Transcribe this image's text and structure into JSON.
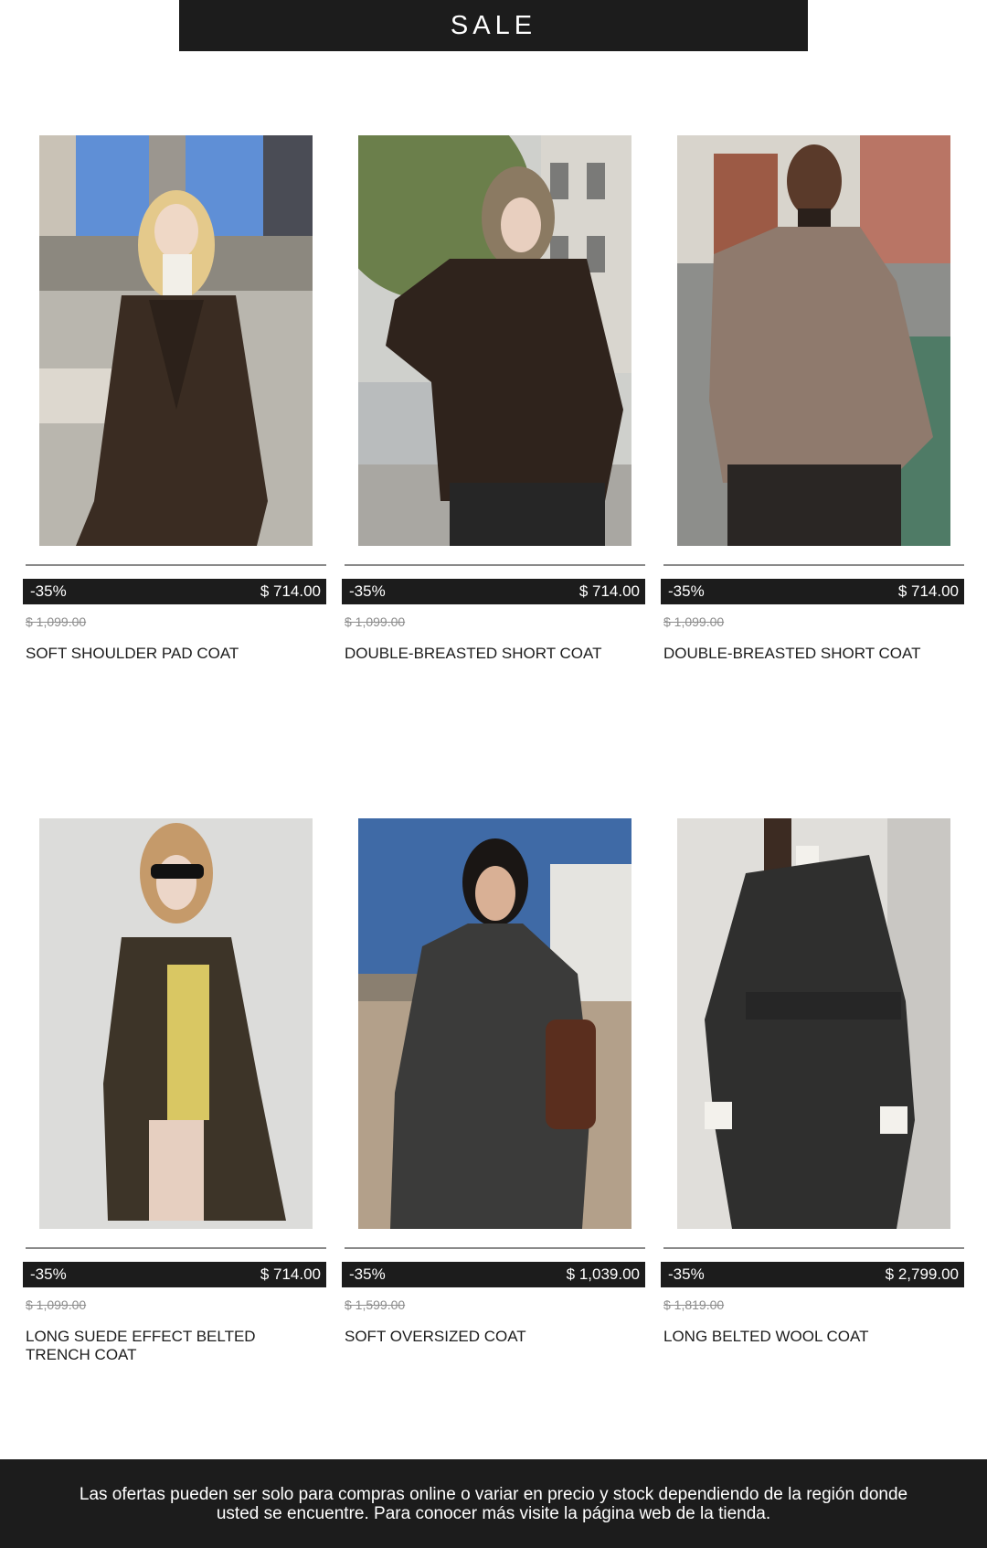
{
  "banner": {
    "title": "SALE"
  },
  "products": [
    {
      "discount": "-35%",
      "price": "$ 714.00",
      "old_price": "$ 1,099.00",
      "name": "SOFT SHOULDER PAD COAT"
    },
    {
      "discount": "-35%",
      "price": "$ 714.00",
      "old_price": "$ 1,099.00",
      "name": "DOUBLE-BREASTED SHORT COAT"
    },
    {
      "discount": "-35%",
      "price": "$ 714.00",
      "old_price": "$ 1,099.00",
      "name": "DOUBLE-BREASTED SHORT COAT"
    },
    {
      "discount": "-35%",
      "price": "$ 714.00",
      "old_price": "$ 1,099.00",
      "name": "LONG SUEDE EFFECT BELTED TRENCH COAT"
    },
    {
      "discount": "-35%",
      "price": "$ 1,039.00",
      "old_price": "$ 1,599.00",
      "name": "SOFT OVERSIZED COAT"
    },
    {
      "discount": "-35%",
      "price": "$ 2,799.00",
      "old_price": "$ 1,819.00",
      "name": "LONG BELTED WOOL COAT"
    }
  ],
  "footer": {
    "disclaimer": "Las ofertas pueden ser solo para compras online o variar en precio y stock dependiendo de la región donde usted se encuentre. Para conocer más visite la página web de la tienda."
  },
  "colors": {
    "banner_background": "#1c1c1c",
    "banner_text": "#ffffff",
    "old_price_text": "#8d8d8d",
    "divider": "#8a8a8a"
  }
}
